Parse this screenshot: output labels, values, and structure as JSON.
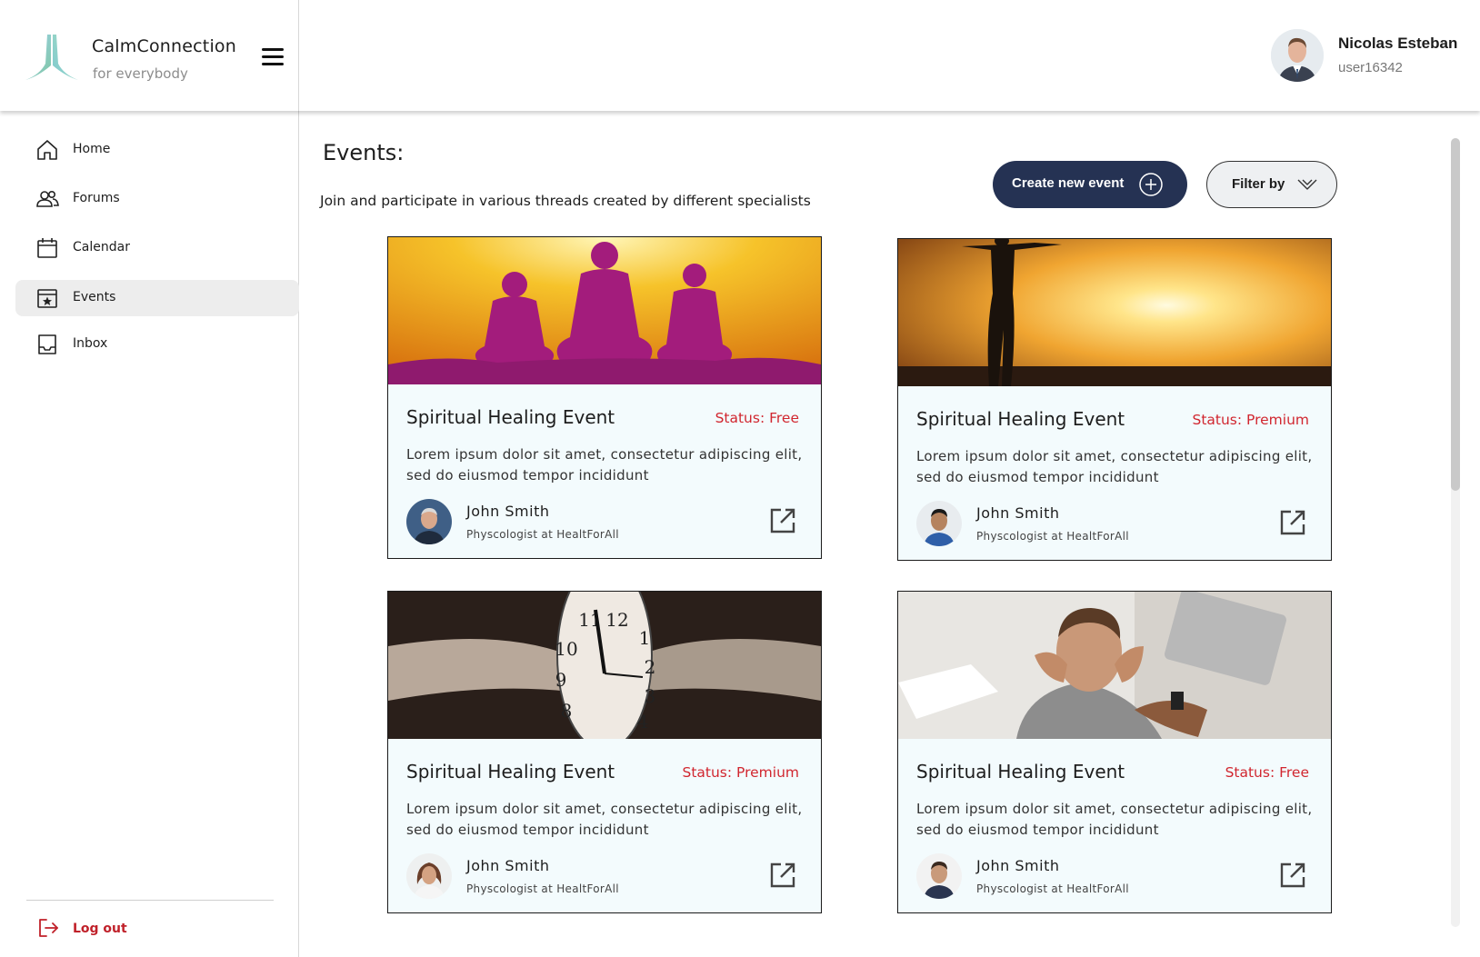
{
  "brand": {
    "name": "CalmConnection",
    "tagline": "for everybody"
  },
  "user": {
    "name": "Nicolas Esteban",
    "id": "user16342"
  },
  "sidebar": {
    "items": [
      {
        "label": "Home",
        "icon": "home-icon"
      },
      {
        "label": "Forums",
        "icon": "users-icon"
      },
      {
        "label": "Calendar",
        "icon": "calendar-icon"
      },
      {
        "label": "Events",
        "icon": "calendar-star-icon",
        "active": true
      },
      {
        "label": "Inbox",
        "icon": "inbox-icon"
      }
    ],
    "logout_label": "Log out"
  },
  "main": {
    "title": "Events:",
    "subtitle": "Join and participate in various threads created by different specialists",
    "create_label": "Create new event",
    "filter_label": "Filter by"
  },
  "cards": [
    {
      "title": "Spiritual Healing Event",
      "status": "Status: Free",
      "desc": "Lorem ipsum dolor sit amet, consectetur adipiscing elit, sed do eiusmod tempor incididunt",
      "author": "John Smith",
      "role": "Physcologist at HealtForAll",
      "image": "meditation-silhouettes"
    },
    {
      "title": "Spiritual Healing Event",
      "status": "Status: Premium",
      "desc": "Lorem ipsum dolor sit amet, consectetur adipiscing elit, sed do eiusmod tempor incididunt",
      "author": "John Smith",
      "role": "Physcologist at HealtForAll",
      "image": "sunset-silhouette"
    },
    {
      "title": "Spiritual Healing Event",
      "status": "Status: Premium",
      "desc": "Lorem ipsum dolor sit amet, consectetur adipiscing elit, sed do eiusmod tempor incididunt",
      "author": "John Smith",
      "role": "Physcologist at HealtForAll",
      "image": "clock-stress"
    },
    {
      "title": "Spiritual Healing Event",
      "status": "Status: Free",
      "desc": "Lorem ipsum dolor sit amet, consectetur adipiscing elit, sed do eiusmod tempor incididunt",
      "author": "John Smith",
      "role": "Physcologist at HealtForAll",
      "image": "stressed-man"
    }
  ],
  "colors": {
    "primary": "#253253",
    "accent_red": "#d1262f",
    "card_bg": "#f3fbfd"
  }
}
